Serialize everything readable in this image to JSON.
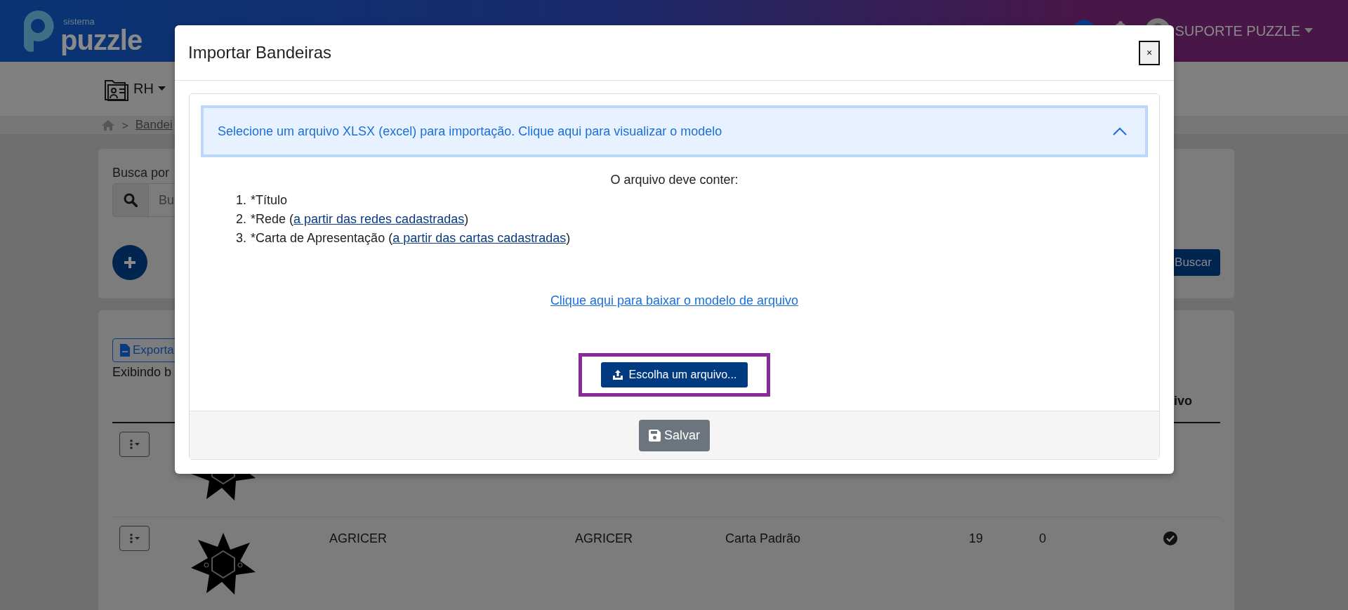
{
  "header": {
    "logo_small": "sistema",
    "logo_main": "puzzle",
    "user_name": "SUPORTE PUZZLE"
  },
  "nav": {
    "module": "RH"
  },
  "breadcrumb": {
    "separator": ">",
    "current": "Bandei"
  },
  "search_card": {
    "label": "Busca por",
    "placeholder": "Bu",
    "search_button": "Buscar"
  },
  "results": {
    "export_button": "Exporta",
    "summary": "Exibindo b",
    "column_8": "ivo",
    "rows": [
      {
        "cells": []
      },
      {
        "cells": [
          "AGRICER",
          "AGRICER",
          "Carta Padrão",
          "19",
          "0"
        ],
        "active": true
      }
    ]
  },
  "modal": {
    "title": "Importar Bandeiras",
    "close": "×",
    "accordion": {
      "text": "Selecione um arquivo XLSX (excel) para importação. Clique aqui para visualizar o modelo",
      "expanded": true
    },
    "intro": "O arquivo deve conter:",
    "items": [
      {
        "number": "1.",
        "text": "*Título"
      },
      {
        "number": "2.",
        "text": "*Rede (",
        "link": "a partir das redes cadastradas",
        "after": ")"
      },
      {
        "number": "3.",
        "text": "*Carta de Apresentação (",
        "link": "a partir das cartas cadastradas",
        "after": ")"
      }
    ],
    "download_link": "Clique aqui para baixar o modelo de arquivo",
    "upload_button": "Escolha um arquivo...",
    "save_button": "Salvar"
  }
}
